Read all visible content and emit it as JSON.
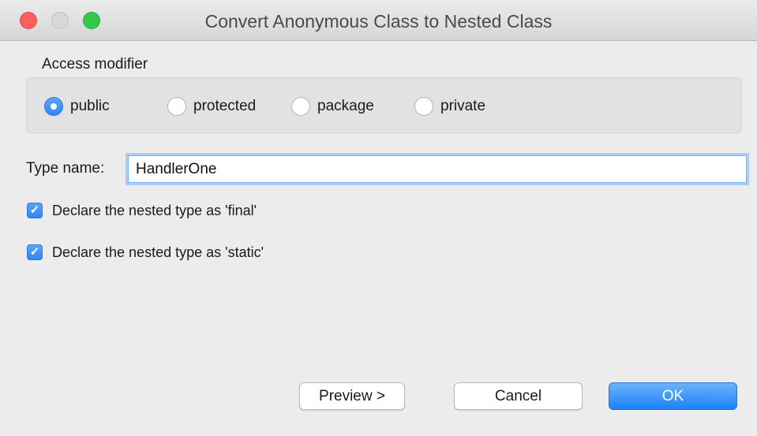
{
  "window": {
    "title": "Convert Anonymous Class to Nested Class"
  },
  "access_modifier": {
    "label": "Access modifier",
    "options": [
      {
        "label": "public",
        "checked": true
      },
      {
        "label": "protected",
        "checked": false
      },
      {
        "label": "package",
        "checked": false
      },
      {
        "label": "private",
        "checked": false
      }
    ]
  },
  "type_name": {
    "label": "Type name:",
    "value": "HandlerOne"
  },
  "options": {
    "final_label": "Declare the nested type as 'final'",
    "final_checked": true,
    "static_label": "Declare the nested type as 'static'",
    "static_checked": true
  },
  "buttons": {
    "preview": "Preview >",
    "cancel": "Cancel",
    "ok": "OK"
  },
  "colors": {
    "accent": "#2f86f4",
    "close": "#fc605c",
    "zoom": "#34c84a"
  }
}
